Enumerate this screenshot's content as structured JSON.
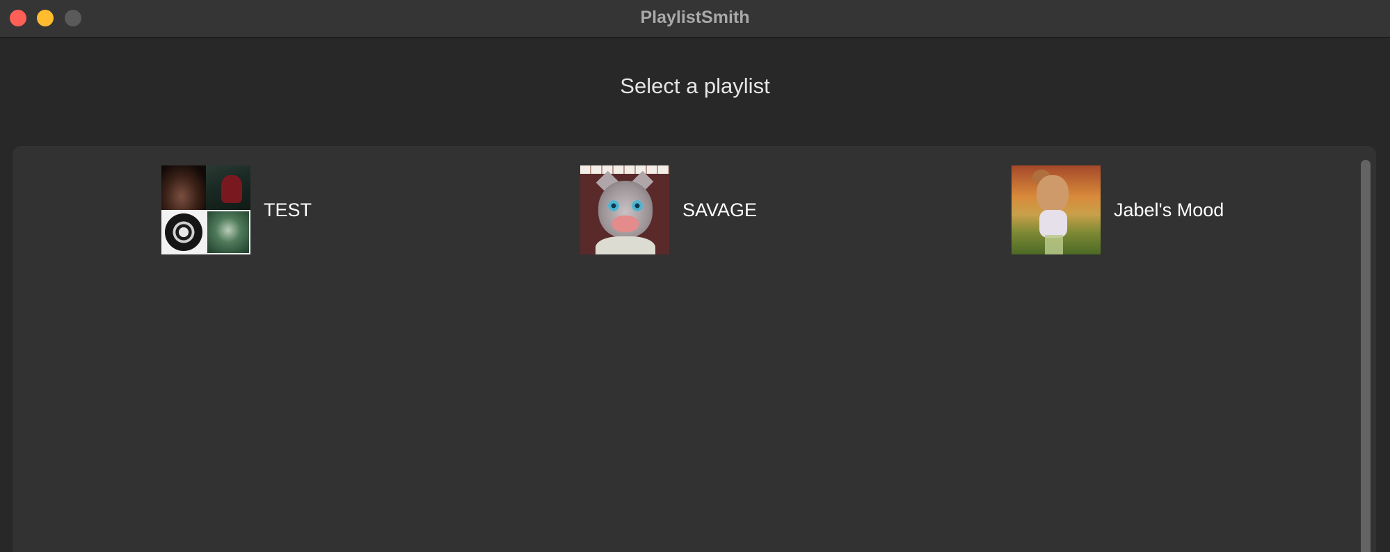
{
  "window": {
    "title": "PlaylistSmith",
    "controls": [
      "close",
      "minimize",
      "zoom"
    ]
  },
  "header": {
    "heading": "Select a playlist"
  },
  "playlists": [
    {
      "name": "TEST",
      "cover": "four-image-mosaic"
    },
    {
      "name": "SAVAGE",
      "cover": "boar-mask-character"
    },
    {
      "name": "Jabel's Mood",
      "cover": "cartoon-character-in-field"
    }
  ],
  "colors": {
    "background": "#282828",
    "titlebar": "#353535",
    "panel": "#323232",
    "text": "#ffffff",
    "close": "#fe5f57",
    "minimize": "#febc2e",
    "zoom": "#5a5a5a"
  }
}
